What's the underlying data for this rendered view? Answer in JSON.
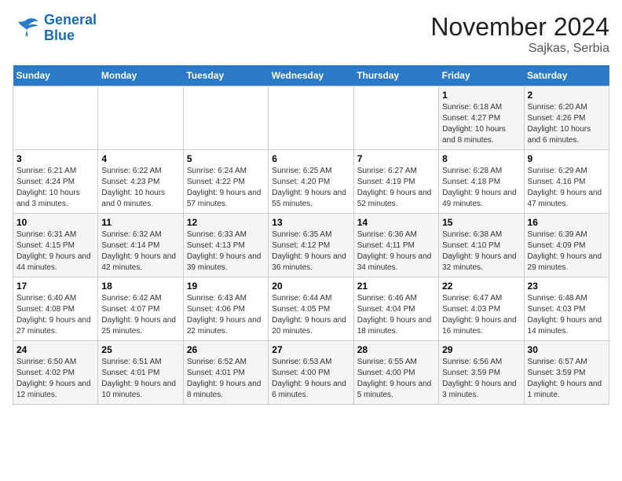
{
  "logo": {
    "line1": "General",
    "line2": "Blue"
  },
  "title": "November 2024",
  "subtitle": "Sajkas, Serbia",
  "days_of_week": [
    "Sunday",
    "Monday",
    "Tuesday",
    "Wednesday",
    "Thursday",
    "Friday",
    "Saturday"
  ],
  "weeks": [
    [
      {
        "day": "",
        "info": ""
      },
      {
        "day": "",
        "info": ""
      },
      {
        "day": "",
        "info": ""
      },
      {
        "day": "",
        "info": ""
      },
      {
        "day": "",
        "info": ""
      },
      {
        "day": "1",
        "info": "Sunrise: 6:18 AM\nSunset: 4:27 PM\nDaylight: 10 hours and 8 minutes."
      },
      {
        "day": "2",
        "info": "Sunrise: 6:20 AM\nSunset: 4:26 PM\nDaylight: 10 hours and 6 minutes."
      }
    ],
    [
      {
        "day": "3",
        "info": "Sunrise: 6:21 AM\nSunset: 4:24 PM\nDaylight: 10 hours and 3 minutes."
      },
      {
        "day": "4",
        "info": "Sunrise: 6:22 AM\nSunset: 4:23 PM\nDaylight: 10 hours and 0 minutes."
      },
      {
        "day": "5",
        "info": "Sunrise: 6:24 AM\nSunset: 4:22 PM\nDaylight: 9 hours and 57 minutes."
      },
      {
        "day": "6",
        "info": "Sunrise: 6:25 AM\nSunset: 4:20 PM\nDaylight: 9 hours and 55 minutes."
      },
      {
        "day": "7",
        "info": "Sunrise: 6:27 AM\nSunset: 4:19 PM\nDaylight: 9 hours and 52 minutes."
      },
      {
        "day": "8",
        "info": "Sunrise: 6:28 AM\nSunset: 4:18 PM\nDaylight: 9 hours and 49 minutes."
      },
      {
        "day": "9",
        "info": "Sunrise: 6:29 AM\nSunset: 4:16 PM\nDaylight: 9 hours and 47 minutes."
      }
    ],
    [
      {
        "day": "10",
        "info": "Sunrise: 6:31 AM\nSunset: 4:15 PM\nDaylight: 9 hours and 44 minutes."
      },
      {
        "day": "11",
        "info": "Sunrise: 6:32 AM\nSunset: 4:14 PM\nDaylight: 9 hours and 42 minutes."
      },
      {
        "day": "12",
        "info": "Sunrise: 6:33 AM\nSunset: 4:13 PM\nDaylight: 9 hours and 39 minutes."
      },
      {
        "day": "13",
        "info": "Sunrise: 6:35 AM\nSunset: 4:12 PM\nDaylight: 9 hours and 36 minutes."
      },
      {
        "day": "14",
        "info": "Sunrise: 6:36 AM\nSunset: 4:11 PM\nDaylight: 9 hours and 34 minutes."
      },
      {
        "day": "15",
        "info": "Sunrise: 6:38 AM\nSunset: 4:10 PM\nDaylight: 9 hours and 32 minutes."
      },
      {
        "day": "16",
        "info": "Sunrise: 6:39 AM\nSunset: 4:09 PM\nDaylight: 9 hours and 29 minutes."
      }
    ],
    [
      {
        "day": "17",
        "info": "Sunrise: 6:40 AM\nSunset: 4:08 PM\nDaylight: 9 hours and 27 minutes."
      },
      {
        "day": "18",
        "info": "Sunrise: 6:42 AM\nSunset: 4:07 PM\nDaylight: 9 hours and 25 minutes."
      },
      {
        "day": "19",
        "info": "Sunrise: 6:43 AM\nSunset: 4:06 PM\nDaylight: 9 hours and 22 minutes."
      },
      {
        "day": "20",
        "info": "Sunrise: 6:44 AM\nSunset: 4:05 PM\nDaylight: 9 hours and 20 minutes."
      },
      {
        "day": "21",
        "info": "Sunrise: 6:46 AM\nSunset: 4:04 PM\nDaylight: 9 hours and 18 minutes."
      },
      {
        "day": "22",
        "info": "Sunrise: 6:47 AM\nSunset: 4:03 PM\nDaylight: 9 hours and 16 minutes."
      },
      {
        "day": "23",
        "info": "Sunrise: 6:48 AM\nSunset: 4:03 PM\nDaylight: 9 hours and 14 minutes."
      }
    ],
    [
      {
        "day": "24",
        "info": "Sunrise: 6:50 AM\nSunset: 4:02 PM\nDaylight: 9 hours and 12 minutes."
      },
      {
        "day": "25",
        "info": "Sunrise: 6:51 AM\nSunset: 4:01 PM\nDaylight: 9 hours and 10 minutes."
      },
      {
        "day": "26",
        "info": "Sunrise: 6:52 AM\nSunset: 4:01 PM\nDaylight: 9 hours and 8 minutes."
      },
      {
        "day": "27",
        "info": "Sunrise: 6:53 AM\nSunset: 4:00 PM\nDaylight: 9 hours and 6 minutes."
      },
      {
        "day": "28",
        "info": "Sunrise: 6:55 AM\nSunset: 4:00 PM\nDaylight: 9 hours and 5 minutes."
      },
      {
        "day": "29",
        "info": "Sunrise: 6:56 AM\nSunset: 3:59 PM\nDaylight: 9 hours and 3 minutes."
      },
      {
        "day": "30",
        "info": "Sunrise: 6:57 AM\nSunset: 3:59 PM\nDaylight: 9 hours and 1 minute."
      }
    ]
  ]
}
